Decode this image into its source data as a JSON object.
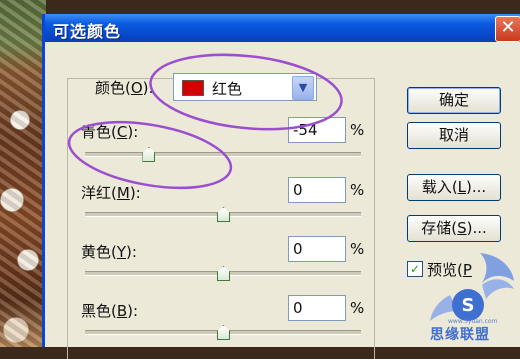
{
  "window": {
    "title": "可选颜色"
  },
  "close_symbol": "✕",
  "colors": {
    "dropdown": {
      "label": "颜色(",
      "accel": "O",
      "suffix": "):",
      "value": "红色",
      "swatch_color": "#d40000"
    }
  },
  "sliders": [
    {
      "id": "cyan",
      "label": "青色(",
      "accel": "C",
      "suffix": "):",
      "value": "-54",
      "unit": "%",
      "level_percent": 23
    },
    {
      "id": "magenta",
      "label": "洋红(",
      "accel": "M",
      "suffix": "):",
      "value": "0",
      "unit": "%",
      "level_percent": 50
    },
    {
      "id": "yellow",
      "label": "黄色(",
      "accel": "Y",
      "suffix": "):",
      "value": "0",
      "unit": "%",
      "level_percent": 50
    },
    {
      "id": "black",
      "label": "黑色(",
      "accel": "B",
      "suffix": "):",
      "value": "0",
      "unit": "%",
      "level_percent": 50
    }
  ],
  "buttons": {
    "ok": "确定",
    "cancel": "取消",
    "load": {
      "label": "载入(",
      "accel": "L",
      "suffix": ")..."
    },
    "save": {
      "label": "存储(",
      "accel": "S",
      "suffix": ")..."
    }
  },
  "preview": {
    "label": "预览(",
    "accel": "P",
    "suffix": "",
    "checked": true,
    "check_symbol": "✓"
  },
  "watermark": {
    "name": "思缘联盟",
    "url": "www.5yuan.com",
    "logo_letter": "S"
  },
  "accent": "#0846c8",
  "annotation_color": "#9b4fd0"
}
